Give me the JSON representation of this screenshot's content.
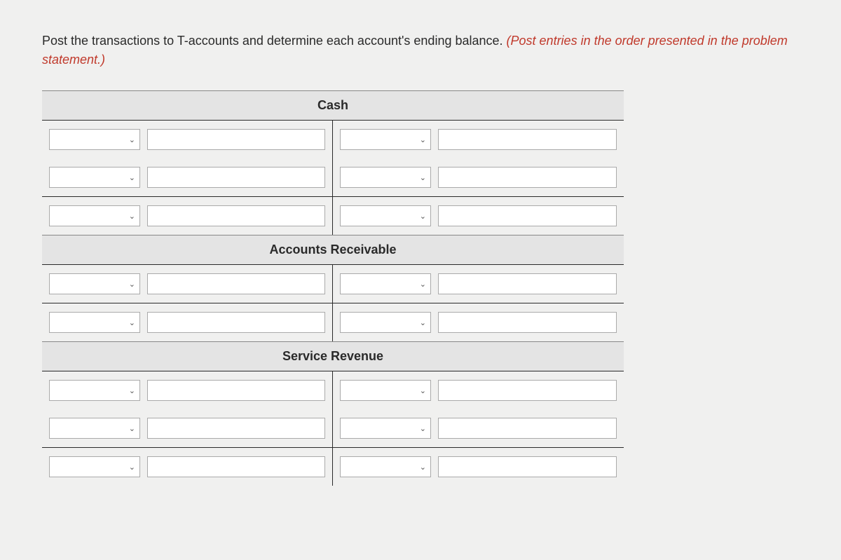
{
  "instruction": {
    "main": "Post the transactions to T-accounts and determine each account's ending balance. ",
    "emph": "(Post entries in the order presented in the problem statement.)"
  },
  "accounts": [
    {
      "title": "Cash",
      "rows": 3,
      "sepBefore": [
        2
      ]
    },
    {
      "title": "Accounts Receivable",
      "rows": 2,
      "sepBefore": [
        1
      ]
    },
    {
      "title": "Service Revenue",
      "rows": 3,
      "sepBefore": [
        2
      ]
    }
  ]
}
